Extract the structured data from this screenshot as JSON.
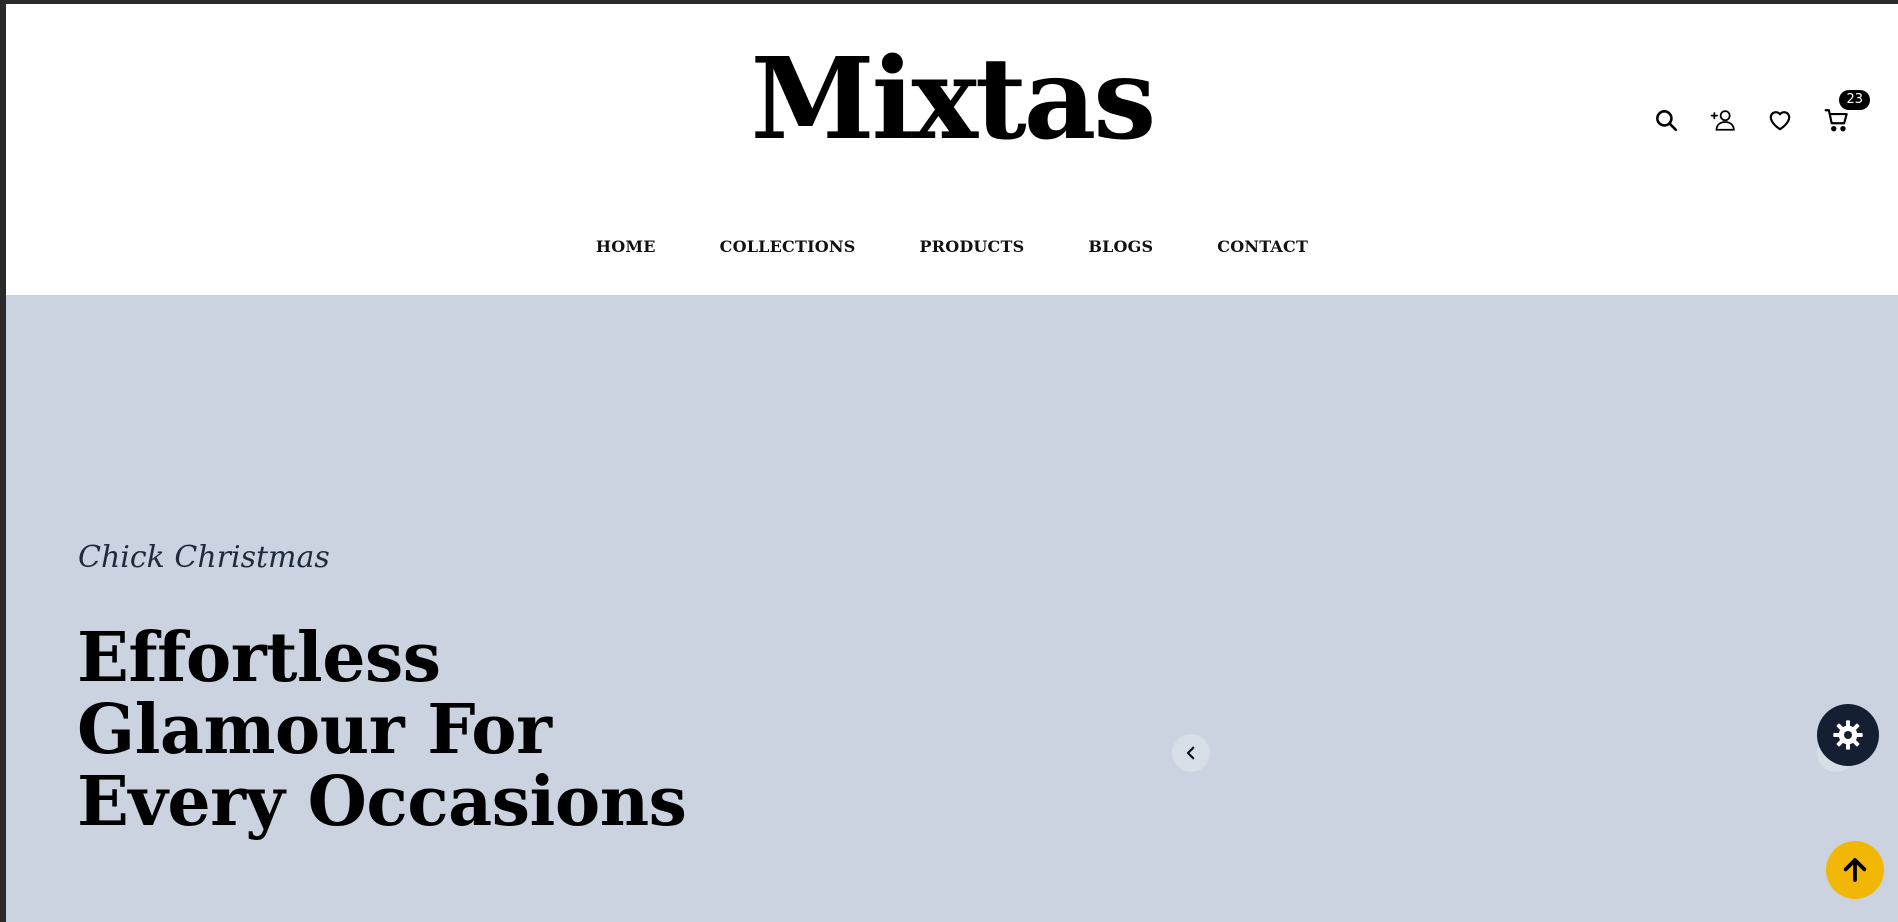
{
  "brand": {
    "logo_text": "Mixtas"
  },
  "header_icons": {
    "search": "search-icon",
    "account": "user-plus-icon",
    "wishlist": "heart-icon",
    "cart": "cart-icon",
    "cart_count": "23"
  },
  "nav": {
    "items": [
      {
        "label": "HOME"
      },
      {
        "label": "COLLECTIONS"
      },
      {
        "label": "PRODUCTS"
      },
      {
        "label": "BLOGS"
      },
      {
        "label": "CONTACT"
      }
    ]
  },
  "hero": {
    "eyebrow": "Chick Christmas",
    "headline_lines": [
      "Effortless",
      "Glamour For",
      "Every Occasions"
    ],
    "background_color": "#cad3df",
    "prev_icon": "chevron-left-icon",
    "next_icon": "chevron-right-icon"
  },
  "floating": {
    "settings_icon": "gear-icon",
    "settings_color": "#142031",
    "back_to_top_icon": "arrow-up-icon",
    "back_to_top_color": "#f2b705"
  }
}
